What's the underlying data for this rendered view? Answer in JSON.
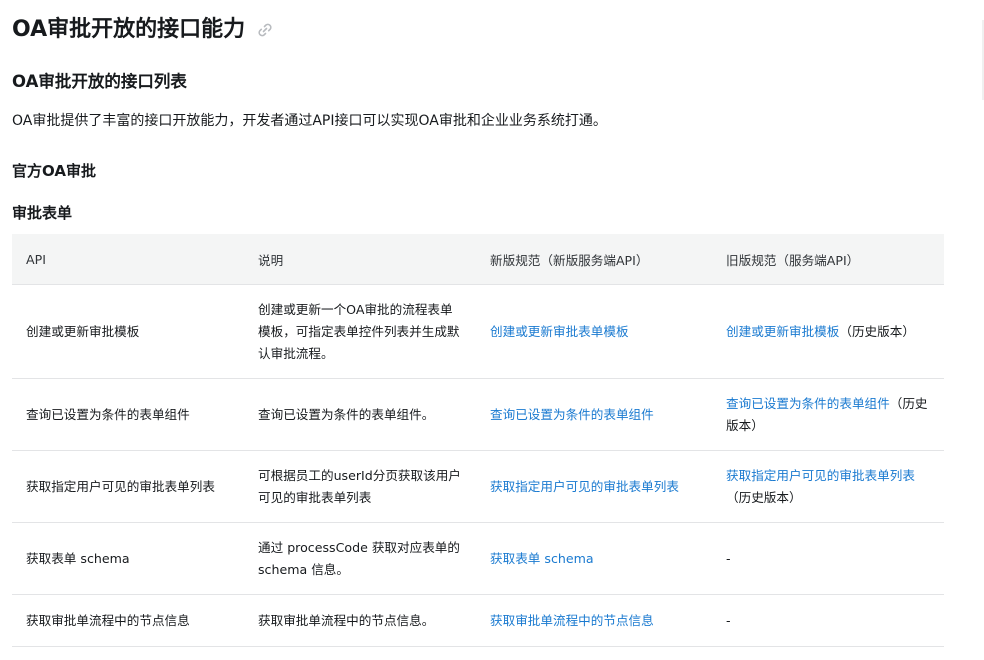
{
  "page": {
    "title": "OA审批开放的接口能力",
    "section_title": "OA审批开放的接口列表",
    "intro": "OA审批提供了丰富的接口开放能力，开发者通过API接口可以实现OA审批和企业业务系统打通。",
    "subheading_official": "官方OA审批",
    "subheading_form": "审批表单"
  },
  "icons": {
    "anchor_link": "link-icon"
  },
  "colors": {
    "link": "#1a7ad0",
    "header_bg": "#f4f5f5"
  },
  "table": {
    "headers": [
      "API",
      "说明",
      "新版规范（新版服务端API）",
      "旧版规范（服务端API）"
    ],
    "rows": [
      {
        "api": "创建或更新审批模板",
        "desc": "创建或更新一个OA审批的流程表单模板，可指定表单控件列表并生成默认审批流程。",
        "new_link": "创建或更新审批表单模板",
        "old_link": "创建或更新审批模板",
        "old_suffix": "（历史版本）"
      },
      {
        "api": "查询已设置为条件的表单组件",
        "desc": "查询已设置为条件的表单组件。",
        "new_link": "查询已设置为条件的表单组件",
        "old_link": "查询已设置为条件的表单组件",
        "old_suffix": "（历史版本）"
      },
      {
        "api": "获取指定用户可见的审批表单列表",
        "desc": "可根据员工的userId分页获取该用户可见的审批表单列表",
        "new_link": "获取指定用户可见的审批表单列表",
        "old_link": "获取指定用户可见的审批表单列表",
        "old_suffix": "（历史版本）"
      },
      {
        "api": "获取表单 schema",
        "desc": "通过 processCode 获取对应表单的 schema 信息。",
        "new_link": "获取表单 schema",
        "old_link": "",
        "old_suffix": "-"
      },
      {
        "api": "获取审批单流程中的节点信息",
        "desc": "获取审批单流程中的节点信息。",
        "new_link": "获取审批单流程中的节点信息",
        "old_link": "",
        "old_suffix": "-"
      }
    ]
  }
}
